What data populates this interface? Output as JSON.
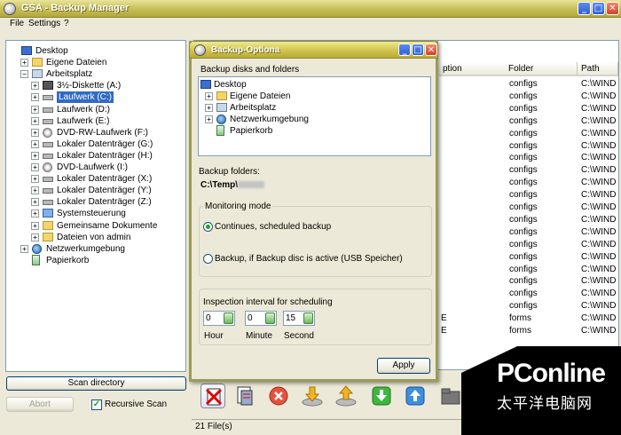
{
  "window": {
    "title": "GSA - Backup Manager",
    "minimize": "_",
    "maximize": "□",
    "close": "✕"
  },
  "menu": {
    "file": "File",
    "settings": "Settings",
    "help": "?"
  },
  "left_tree": {
    "items": [
      {
        "label": "Desktop",
        "icon": "desktop-icon"
      },
      {
        "label": "Eigene Dateien",
        "icon": "folder-icon"
      },
      {
        "label": "Arbeitsplatz",
        "icon": "computer-icon"
      },
      {
        "label": "3½-Diskette (A:)",
        "icon": "floppy-icon"
      },
      {
        "label": "Laufwerk (C:)",
        "icon": "drive-icon",
        "selected": true
      },
      {
        "label": "Laufwerk (D:)",
        "icon": "drive-icon"
      },
      {
        "label": "Laufwerk (E:)",
        "icon": "drive-icon"
      },
      {
        "label": "DVD-RW-Laufwerk (F:)",
        "icon": "cd-icon"
      },
      {
        "label": "Lokaler Datenträger (G:)",
        "icon": "drive-icon"
      },
      {
        "label": "Lokaler Datenträger (H:)",
        "icon": "drive-icon"
      },
      {
        "label": "DVD-Laufwerk (I:)",
        "icon": "cd-icon"
      },
      {
        "label": "Lokaler Datenträger (X:)",
        "icon": "drive-icon"
      },
      {
        "label": "Lokaler Datenträger (Y:)",
        "icon": "drive-icon"
      },
      {
        "label": "Lokaler Datenträger (Z:)",
        "icon": "drive-icon"
      },
      {
        "label": "Systemsteuerung",
        "icon": "control-panel-icon"
      },
      {
        "label": "Gemeinsame Dokumente",
        "icon": "folder-icon"
      },
      {
        "label": "Dateien von admin",
        "icon": "folder-icon"
      },
      {
        "label": "Netzwerkumgebung",
        "icon": "network-icon"
      },
      {
        "label": "Papierkorb",
        "icon": "recycle-bin-icon"
      }
    ]
  },
  "left_buttons": {
    "scan": "Scan directory",
    "abort": "Abort",
    "recursive": "Recursive Scan",
    "recursive_checked": true
  },
  "file_list": {
    "columns": [
      "ption",
      "Folder",
      "Path"
    ],
    "rows": [
      {
        "desc": "",
        "folder": "configs",
        "path": "C:\\WIND"
      },
      {
        "desc": "",
        "folder": "configs",
        "path": "C:\\WIND"
      },
      {
        "desc": "",
        "folder": "configs",
        "path": "C:\\WIND"
      },
      {
        "desc": "",
        "folder": "configs",
        "path": "C:\\WIND"
      },
      {
        "desc": "",
        "folder": "configs",
        "path": "C:\\WIND"
      },
      {
        "desc": "",
        "folder": "configs",
        "path": "C:\\WIND"
      },
      {
        "desc": "",
        "folder": "configs",
        "path": "C:\\WIND"
      },
      {
        "desc": "",
        "folder": "configs",
        "path": "C:\\WIND"
      },
      {
        "desc": "",
        "folder": "configs",
        "path": "C:\\WIND"
      },
      {
        "desc": "",
        "folder": "configs",
        "path": "C:\\WIND"
      },
      {
        "desc": "",
        "folder": "configs",
        "path": "C:\\WIND"
      },
      {
        "desc": "",
        "folder": "configs",
        "path": "C:\\WIND"
      },
      {
        "desc": "",
        "folder": "configs",
        "path": "C:\\WIND"
      },
      {
        "desc": "",
        "folder": "configs",
        "path": "C:\\WIND"
      },
      {
        "desc": "",
        "folder": "configs",
        "path": "C:\\WIND"
      },
      {
        "desc": "",
        "folder": "configs",
        "path": "C:\\WIND"
      },
      {
        "desc": "",
        "folder": "configs",
        "path": "C:\\WIND"
      },
      {
        "desc": "",
        "folder": "configs",
        "path": "C:\\WIND"
      },
      {
        "desc": "",
        "folder": "configs",
        "path": "C:\\WIND"
      },
      {
        "desc": "E",
        "folder": "forms",
        "path": "C:\\WIND"
      },
      {
        "desc": "E",
        "folder": "forms",
        "path": "C:\\WIND"
      }
    ]
  },
  "toolbar_icons": [
    "delete-files-icon",
    "select-files-icon",
    "remove-icon",
    "download-icon",
    "upload-icon",
    "restore-icon",
    "backup-icon",
    "folder-icon"
  ],
  "status": {
    "files": "21 File(s)"
  },
  "dialog": {
    "title": "Backup-Optiona",
    "section_label": "Backup disks and folders",
    "tree": [
      {
        "label": "Desktop",
        "icon": "desktop-icon"
      },
      {
        "label": "Eigene Dateien",
        "icon": "folder-icon"
      },
      {
        "label": "Arbeitsplatz",
        "icon": "computer-icon"
      },
      {
        "label": "Netzwerkumgebung",
        "icon": "network-icon"
      },
      {
        "label": "Papierkorb",
        "icon": "recycle-bin-icon"
      }
    ],
    "backup_folders_label": "Backup folders:",
    "backup_folder_value": "C:\\Temp\\",
    "monitoring_label": "Monitoring mode",
    "option1": "Continues, scheduled backup",
    "option2": "Backup, if Backup disc is active (USB Speicher)",
    "selected_option": 1,
    "interval_label": "Inspection interval for scheduling",
    "hour_value": "0",
    "minute_value": "0",
    "second_value": "15",
    "hour_label": "Hour",
    "minute_label": "Minute",
    "second_label": "Second",
    "apply": "Apply"
  },
  "watermark": {
    "brand": "PConline",
    "sub": "太平洋电脑网"
  }
}
